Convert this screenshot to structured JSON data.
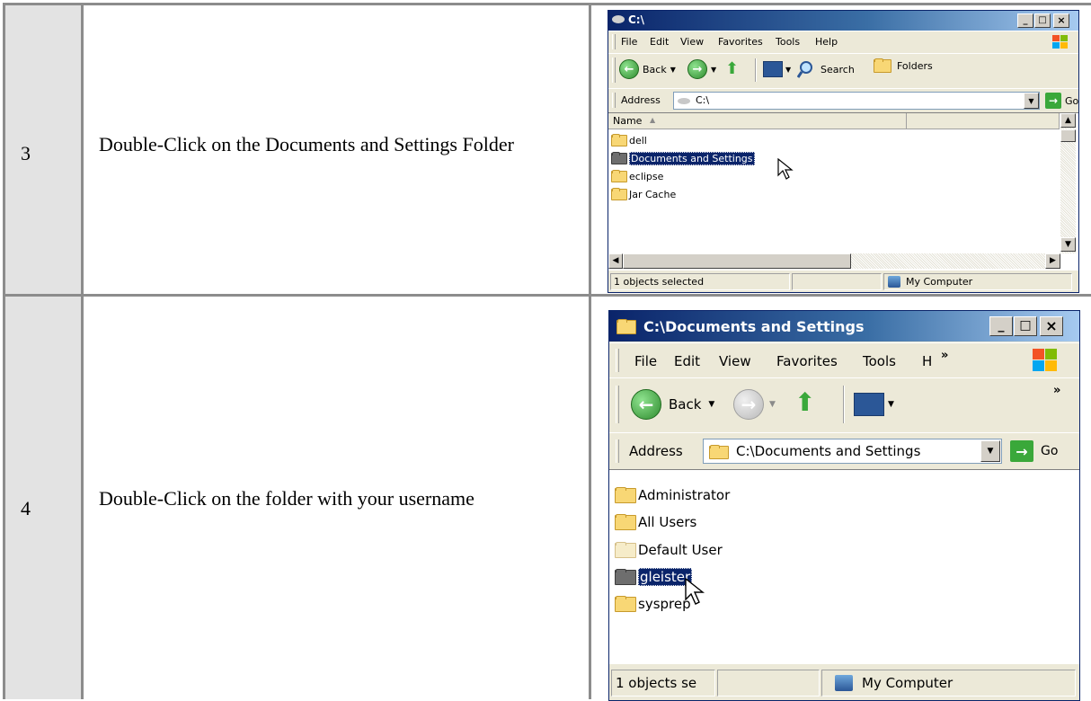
{
  "steps": [
    {
      "number": "3",
      "instruction": "Double-Click on the Documents and Settings Folder",
      "window": {
        "title": "C:\\",
        "menu": [
          "File",
          "Edit",
          "View",
          "Favorites",
          "Tools",
          "Help"
        ],
        "toolbar": {
          "back": "Back",
          "search": "Search",
          "folders": "Folders"
        },
        "address_label": "Address",
        "address_value": "C:\\",
        "go_label": "Go",
        "column_header": "Name",
        "items": [
          "dell",
          "Documents and Settings",
          "eclipse",
          "Jar Cache"
        ],
        "selected_item": "Documents and Settings",
        "status_left": "1 objects selected",
        "status_right": "My Computer"
      }
    },
    {
      "number": "4",
      "instruction": "Double-Click on the folder with your username",
      "window": {
        "title": "C:\\Documents and Settings",
        "menu": [
          "File",
          "Edit",
          "View",
          "Favorites",
          "Tools",
          "H"
        ],
        "toolbar": {
          "back": "Back"
        },
        "address_label": "Address",
        "address_value": "C:\\Documents and Settings",
        "go_label": "Go",
        "items": [
          "Administrator",
          "All Users",
          "Default User",
          "gleister",
          "sysprep"
        ],
        "selected_item": "gleister",
        "status_left": "1 objects se",
        "status_right": "My Computer"
      }
    }
  ],
  "icons": {
    "folder_color": "#f8d775",
    "selected_folder_color": "#6e6e6e",
    "selection_color": "#0a246a",
    "titlebar_color": "#0a246a"
  }
}
